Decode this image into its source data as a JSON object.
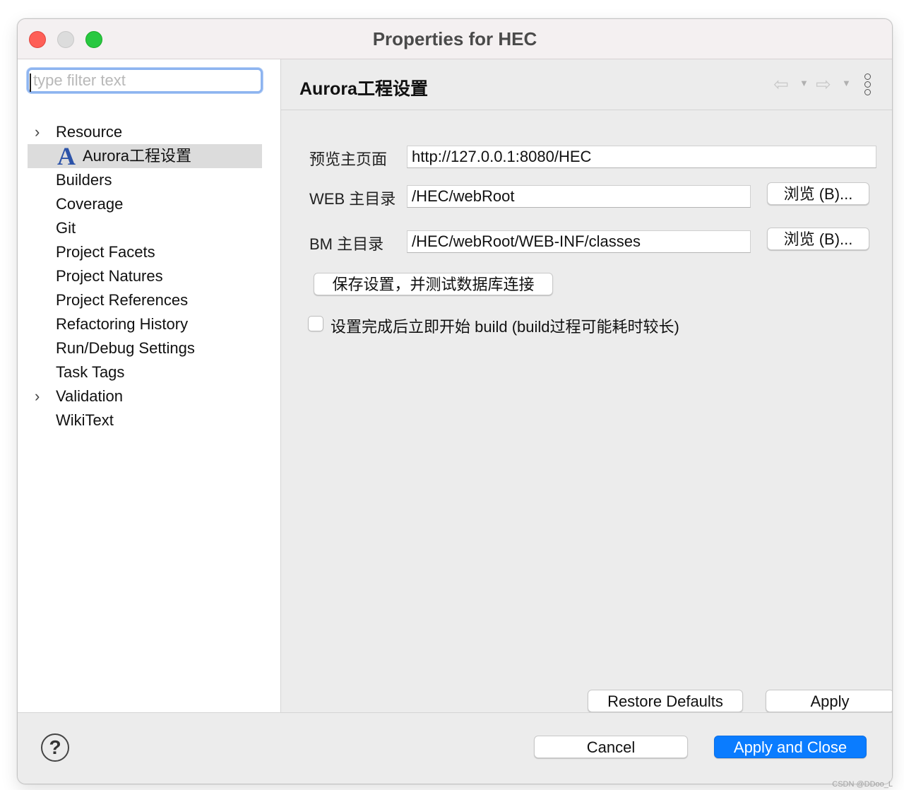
{
  "window": {
    "title": "Properties for HEC"
  },
  "sidebar": {
    "filter_placeholder": "type filter text",
    "items": [
      {
        "label": "Resource",
        "expandable": true
      },
      {
        "label": "Aurora工程设置",
        "selected": true,
        "icon": "aurora-a-icon"
      },
      {
        "label": "Builders"
      },
      {
        "label": "Coverage"
      },
      {
        "label": "Git"
      },
      {
        "label": "Project Facets"
      },
      {
        "label": "Project Natures"
      },
      {
        "label": "Project References"
      },
      {
        "label": "Refactoring History"
      },
      {
        "label": "Run/Debug Settings"
      },
      {
        "label": "Task Tags"
      },
      {
        "label": "Validation",
        "expandable": true
      },
      {
        "label": "WikiText"
      }
    ]
  },
  "main": {
    "title": "Aurora工程设置",
    "fields": {
      "preview": {
        "label": "预览主页面",
        "value": "http://127.0.0.1:8080/HEC"
      },
      "web_root": {
        "label": "WEB 主目录",
        "value": "/HEC/webRoot",
        "browse": "浏览 (B)..."
      },
      "bm_root": {
        "label": "BM 主目录",
        "value": "/HEC/webRoot/WEB-INF/classes",
        "browse": "浏览 (B)..."
      }
    },
    "save_test_button": "保存设置，并测试数据库连接",
    "build_checkbox": {
      "label": "设置完成后立即开始 build (build过程可能耗时较长)",
      "checked": false
    },
    "restore_defaults": "Restore Defaults",
    "apply": "Apply"
  },
  "footer": {
    "help": "?",
    "cancel": "Cancel",
    "apply_close": "Apply and Close"
  },
  "watermark": "CSDN @DDoo_L",
  "colors": {
    "primary": "#0a7cff",
    "selection": "#dcdcdc",
    "focus_ring": "#8db4f0",
    "close": "#fe5f57",
    "zoom": "#28c840"
  }
}
